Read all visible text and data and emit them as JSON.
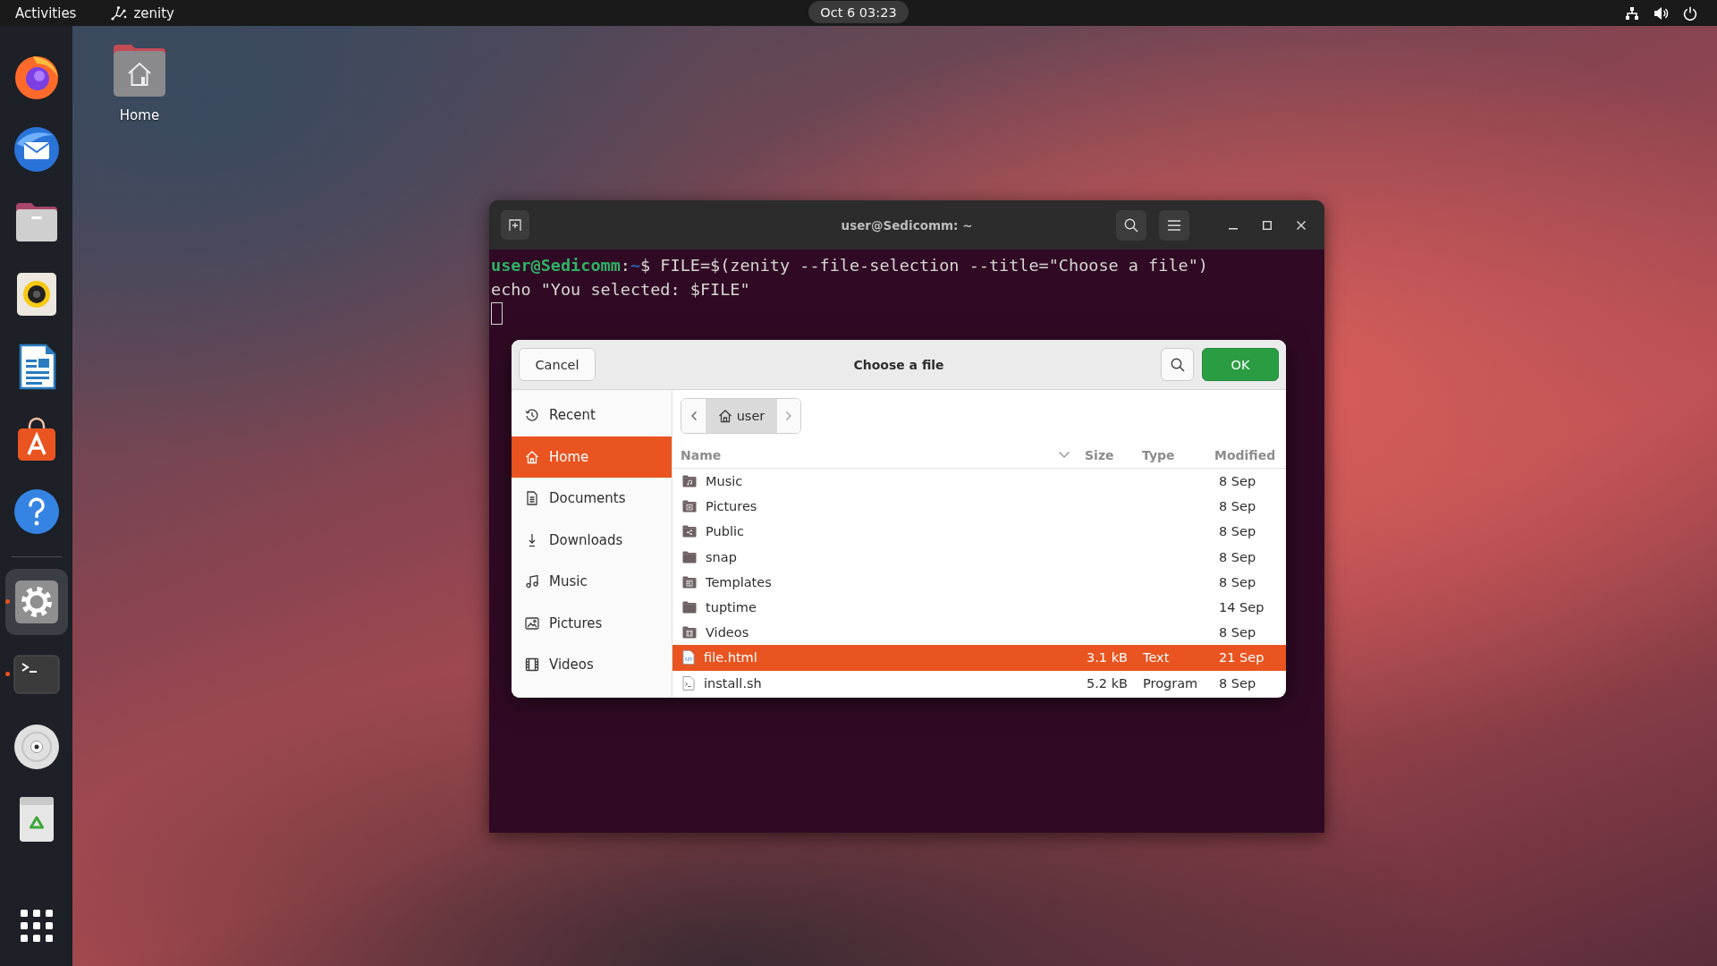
{
  "top_bar": {
    "activities": "Activities",
    "app_menu": "zenity",
    "clock": "Oct 6 03:23"
  },
  "dock": {
    "favorites": [
      {
        "kind": "browser",
        "running": false,
        "highlighted": false
      },
      {
        "kind": "mail",
        "running": false,
        "highlighted": false
      },
      {
        "kind": "files",
        "running": false,
        "highlighted": false
      },
      {
        "kind": "music",
        "running": false,
        "highlighted": false
      },
      {
        "kind": "writer",
        "running": false,
        "highlighted": false
      },
      {
        "kind": "store",
        "running": false,
        "highlighted": false
      },
      {
        "kind": "help",
        "running": false,
        "highlighted": false
      }
    ],
    "others": [
      {
        "kind": "settings",
        "running": true,
        "highlighted": true
      },
      {
        "kind": "terminal",
        "running": true,
        "highlighted": false
      },
      {
        "kind": "disc",
        "running": false,
        "highlighted": false
      },
      {
        "kind": "trash",
        "running": false,
        "highlighted": false
      }
    ]
  },
  "desktop_icons": [
    {
      "label": "Home"
    }
  ],
  "terminal": {
    "title": "user@Sedicomm: ~",
    "lines": [
      {
        "kind": "prompt",
        "user_host": "user@Sedicomm",
        "sep": ":",
        "cwd": "~",
        "text": "$ FILE=$(zenity --file-selection --title=\"Choose a file\")"
      },
      {
        "kind": "plain",
        "text": "echo \"You selected: $FILE\""
      }
    ],
    "cursor": true
  },
  "dialog": {
    "title": "Choose a file",
    "cancel": "Cancel",
    "ok": "OK",
    "sidebar": {
      "items": [
        {
          "kind": "recent",
          "label": "Recent",
          "selected": false
        },
        {
          "kind": "home",
          "label": "Home",
          "selected": true
        },
        {
          "kind": "documents",
          "label": "Documents",
          "selected": false
        },
        {
          "kind": "downloads",
          "label": "Downloads",
          "selected": false
        },
        {
          "kind": "music",
          "label": "Music",
          "selected": false
        },
        {
          "kind": "pictures",
          "label": "Pictures",
          "selected": false
        },
        {
          "kind": "videos",
          "label": "Videos",
          "selected": false
        }
      ]
    },
    "path_bar": {
      "crumbs": [
        {
          "label": "user",
          "selected": true
        }
      ]
    },
    "columns": [
      {
        "label": "Name",
        "sorted": true
      },
      {
        "label": "Size",
        "sorted": false
      },
      {
        "label": "Type",
        "sorted": false
      },
      {
        "label": "Modified",
        "sorted": false
      }
    ],
    "rows": [
      {
        "kind": "music",
        "name": "Music",
        "modified": "8 Sep",
        "selected": false
      },
      {
        "kind": "pictures",
        "name": "Pictures",
        "modified": "8 Sep",
        "selected": false
      },
      {
        "kind": "public",
        "name": "Public",
        "modified": "8 Sep",
        "selected": false
      },
      {
        "kind": "folder",
        "name": "snap",
        "modified": "8 Sep",
        "selected": false
      },
      {
        "kind": "templates",
        "name": "Templates",
        "modified": "8 Sep",
        "selected": false
      },
      {
        "kind": "folder",
        "name": "tuptime",
        "modified": "14 Sep",
        "selected": false
      },
      {
        "kind": "videos",
        "name": "Videos",
        "modified": "8 Sep",
        "selected": false
      },
      {
        "kind": "html",
        "name": "file.html",
        "size": "3.1 kB",
        "type": "Text",
        "modified": "21 Sep",
        "selected": true
      },
      {
        "kind": "script",
        "name": "install.sh",
        "size": "5.2 kB",
        "type": "Program",
        "modified": "8 Sep",
        "selected": false
      }
    ]
  }
}
